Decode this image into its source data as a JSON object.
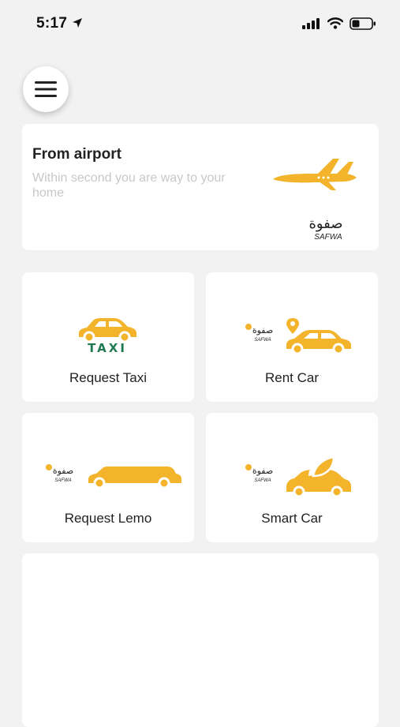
{
  "status_bar": {
    "time": "5:17"
  },
  "airport_card": {
    "title": "From airport",
    "subtitle": "Within second you are way to your home",
    "brand_arabic": "صفوة",
    "brand_latin": "SAFWA"
  },
  "services": [
    {
      "label": "Request Taxi",
      "badge_text": "TAXI",
      "icon": "taxi-car-icon"
    },
    {
      "label": "Rent Car",
      "icon": "rent-car-icon"
    },
    {
      "label": "Request Lemo",
      "icon": "limousine-icon"
    },
    {
      "label": "Smart Car",
      "icon": "eco-car-icon"
    }
  ],
  "small_brand": {
    "arabic": "صفوة",
    "latin": "SAFWA"
  },
  "colors": {
    "accent": "#f3b42c",
    "taxi_green": "#1f7a52",
    "background": "#f2f2f2"
  }
}
